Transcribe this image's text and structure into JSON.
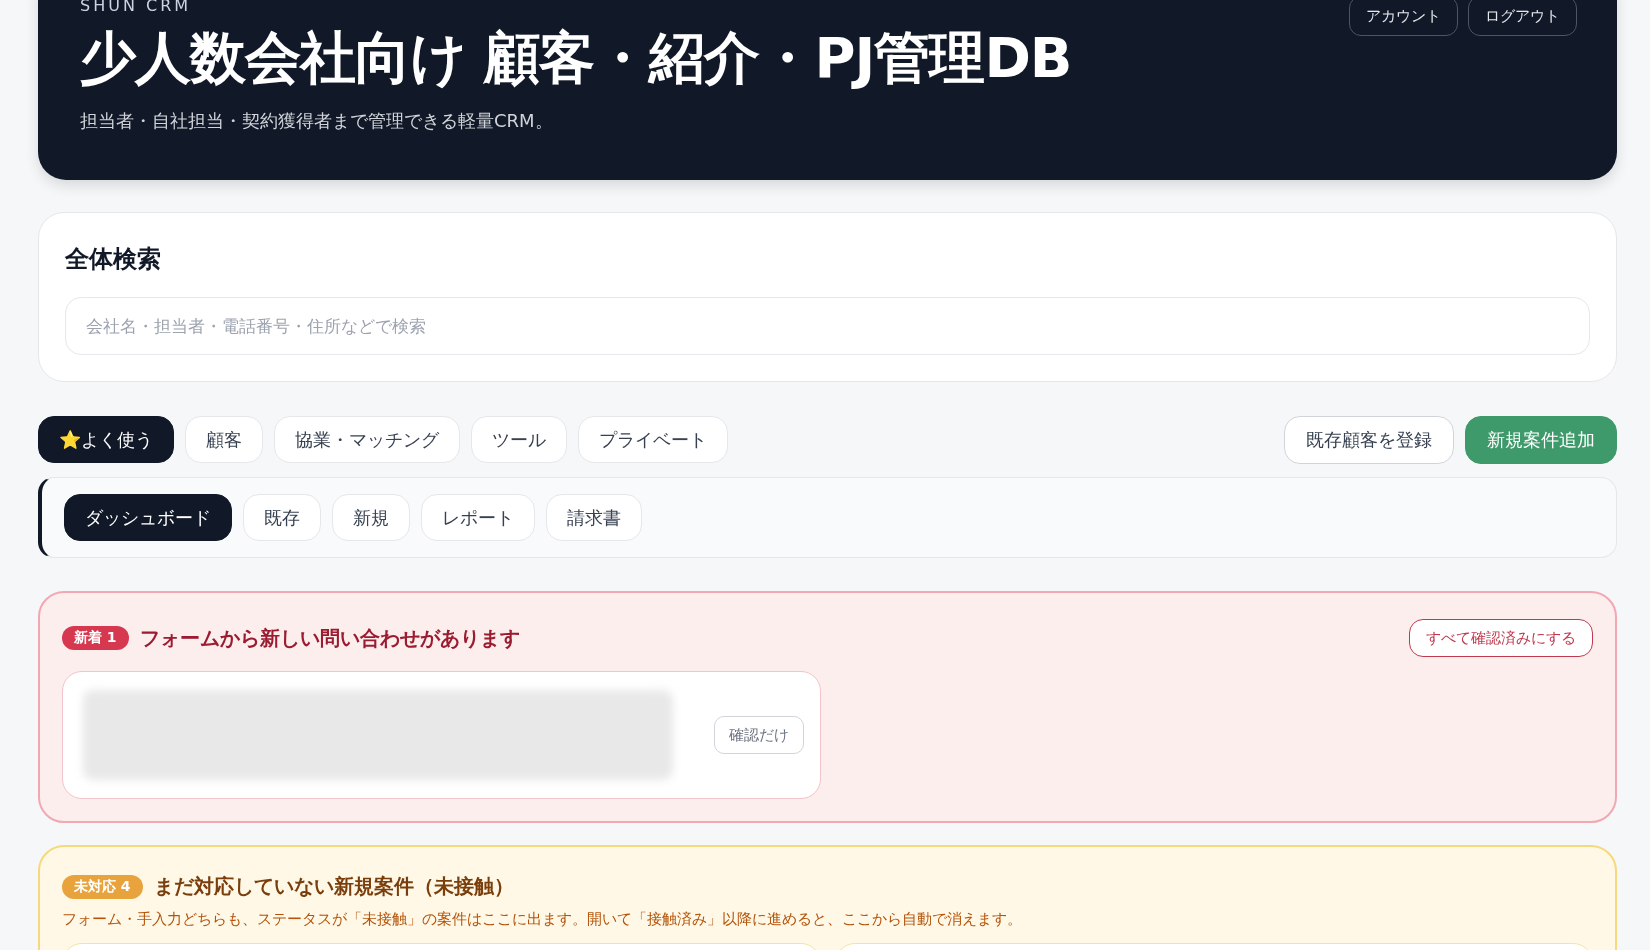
{
  "header": {
    "brand": "SHUN CRM",
    "title": "少人数会社向け 顧客・紹介・PJ管理DB",
    "subtitle": "担当者・自社担当・契約獲得者まで管理できる軽量CRM。",
    "buttons": [
      "アカウント",
      "ログアウト"
    ]
  },
  "search": {
    "heading": "全体検索",
    "placeholder": "会社名・担当者・電話番号・住所などで検索"
  },
  "tabs": [
    {
      "label": "⭐よく使う",
      "selected": true
    },
    {
      "label": "顧客",
      "selected": false
    },
    {
      "label": "協業・マッチング",
      "selected": false
    },
    {
      "label": "ツール",
      "selected": false
    },
    {
      "label": "プライベート",
      "selected": false
    }
  ],
  "actions": [
    {
      "label": "既存顧客を登録",
      "kind": "secondary"
    },
    {
      "label": "新規案件追加",
      "kind": "primary"
    }
  ],
  "subtabs": [
    {
      "label": "ダッシュボード",
      "selected": true
    },
    {
      "label": "既存",
      "selected": false
    },
    {
      "label": "新規",
      "selected": false
    },
    {
      "label": "レポート",
      "selected": false
    },
    {
      "label": "請求書",
      "selected": false
    }
  ],
  "alerts": [
    {
      "kind": "inquiry",
      "badge": "新着 1",
      "title": "フォームから新しい問い合わせがあります",
      "action": "すべて確認済みにする",
      "items": [
        {
          "button": "確認だけ"
        }
      ]
    },
    {
      "kind": "pending",
      "badge": "未対応 4",
      "title": "まだ対応していない新規案件（未接触）",
      "description": "フォーム・手入力どちらも、ステータスが「未接触」の案件はここに出ます。開いて「接触済み」以降に進めると、ここから自動で消えます。"
    }
  ]
}
